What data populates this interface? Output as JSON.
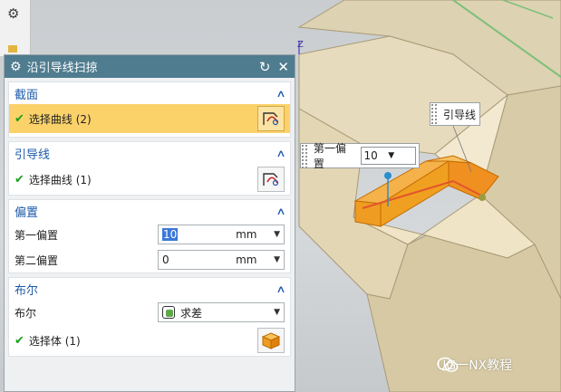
{
  "dialog": {
    "title": "沿引导线扫掠",
    "sections": {
      "section": {
        "header": "截面",
        "row_label": "选择曲线 (2)"
      },
      "guide": {
        "header": "引导线",
        "row_label": "选择曲线 (1)"
      },
      "offset": {
        "header": "偏置",
        "first_label": "第一偏置",
        "first_value": "10",
        "first_unit": "mm",
        "second_label": "第二偏置",
        "second_value": "0",
        "second_unit": "mm"
      },
      "boolean": {
        "header": "布尔",
        "bool_label": "布尔",
        "bool_value": "求差",
        "body_label": "选择体 (1)"
      }
    }
  },
  "viewport": {
    "axis_label": "Z",
    "offset_callout": {
      "label": "第一偏置",
      "value": "10"
    },
    "guide_callout": {
      "label": "引导线"
    },
    "watermark": "UG一NX教程"
  },
  "colors": {
    "titlebar": "#4f7c8f",
    "section_header": "#1d5aa8",
    "selected_row": "#fbd26a",
    "solid_face": "#e3d3a6",
    "sweep_body": "#f0a020"
  }
}
